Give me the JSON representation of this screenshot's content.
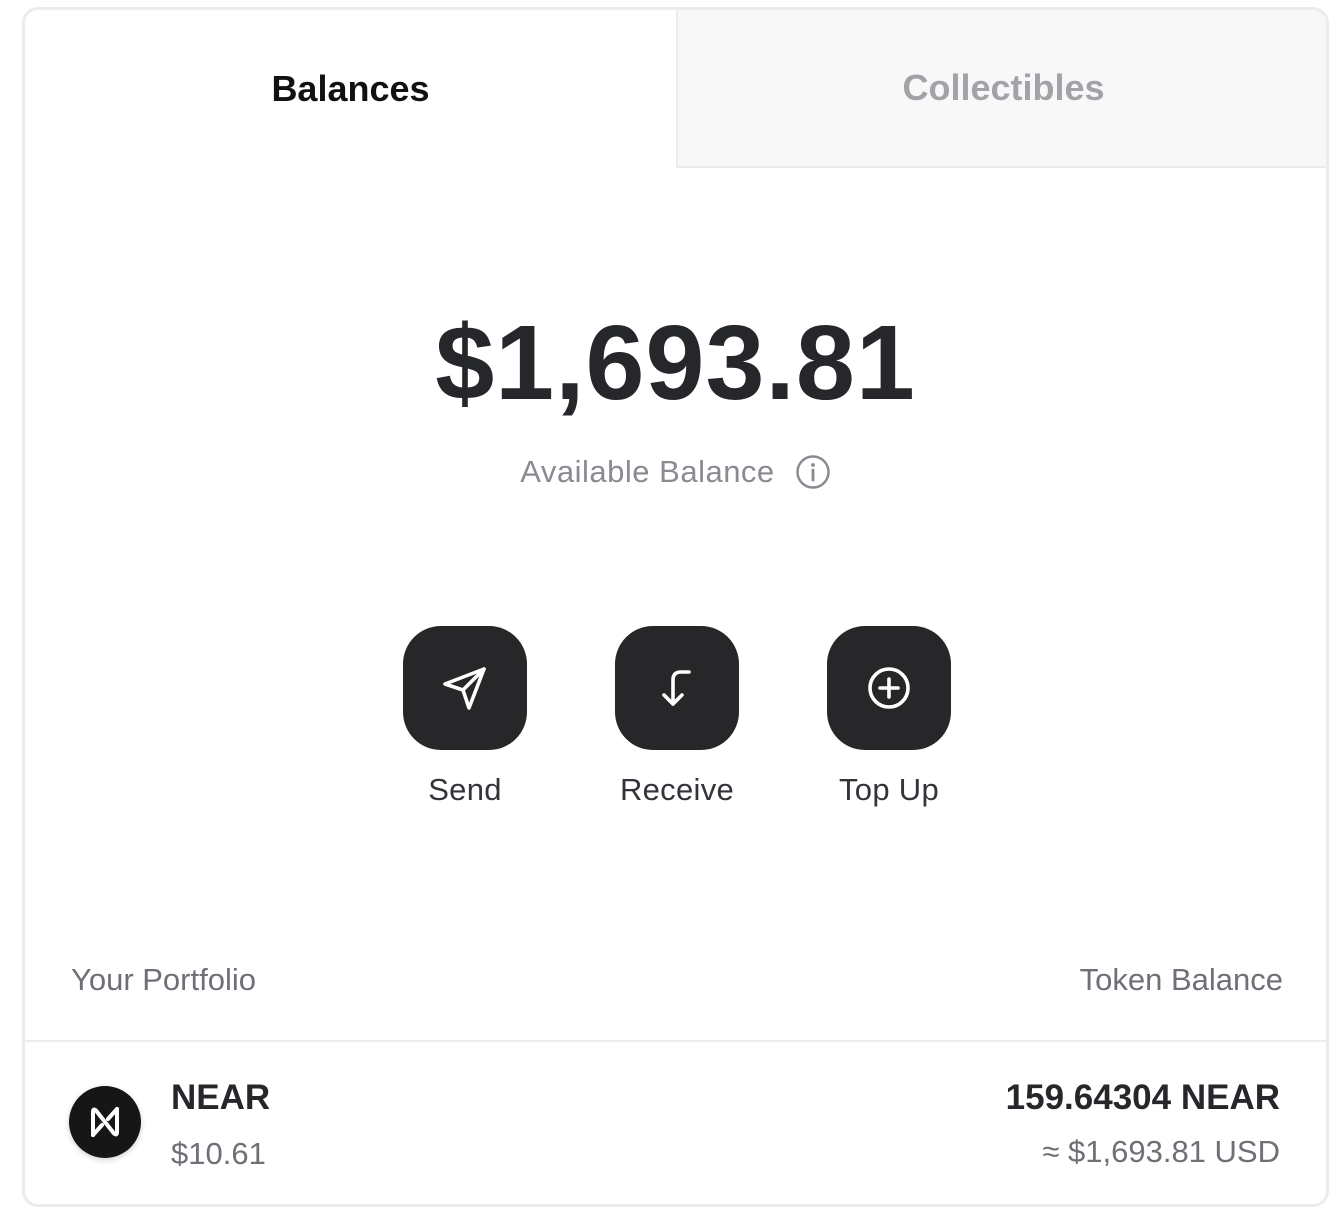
{
  "tabs": [
    {
      "label": "Balances",
      "active": true
    },
    {
      "label": "Collectibles",
      "active": false
    }
  ],
  "balance": {
    "total": "$1,693.81",
    "label": "Available Balance",
    "info_icon": "info-circle-icon"
  },
  "actions": [
    {
      "label": "Send",
      "icon": "send-arrow-icon"
    },
    {
      "label": "Receive",
      "icon": "receive-arrow-icon"
    },
    {
      "label": "Top Up",
      "icon": "plus-circle-icon"
    }
  ],
  "portfolio": {
    "left_header": "Your Portfolio",
    "right_header": "Token Balance",
    "tokens": [
      {
        "name": "NEAR",
        "price": "$10.61",
        "amount": "159.64304 NEAR",
        "usd_value": "≈ $1,693.81 USD",
        "icon": "near-logo-icon"
      }
    ]
  },
  "colors": {
    "primary_dark": "#27272a",
    "muted_text": "#6f6f78",
    "inactive_tab_bg": "#f8f8f8",
    "border": "#ececec"
  }
}
